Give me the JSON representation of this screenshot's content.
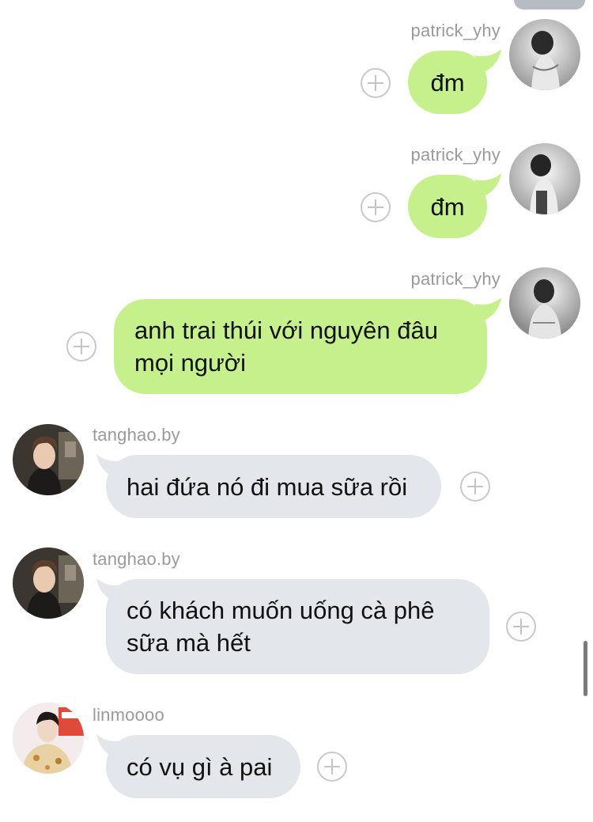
{
  "messages": [
    {
      "sender": "patrick_yhy",
      "direction": "outgoing",
      "text": "đm"
    },
    {
      "sender": "patrick_yhy",
      "direction": "outgoing",
      "text": "đm"
    },
    {
      "sender": "patrick_yhy",
      "direction": "outgoing",
      "lines": [
        "anh trai thúi với nguyên đâu",
        "mọi người"
      ]
    },
    {
      "sender": "tanghao.by",
      "direction": "incoming",
      "text": "hai đứa nó đi mua sữa rồi"
    },
    {
      "sender": "tanghao.by",
      "direction": "incoming",
      "lines": [
        "có khách muốn uống cà phê",
        "sữa mà hết"
      ]
    },
    {
      "sender": "linmoooo",
      "direction": "incoming",
      "text": "có vụ gì à pai"
    }
  ],
  "colors": {
    "outgoing_bubble": "#c6f08c",
    "incoming_bubble": "#e3e6ea",
    "sender_name": "#9a9a9a"
  },
  "icons": {
    "add_reaction": "add-reaction-icon"
  }
}
